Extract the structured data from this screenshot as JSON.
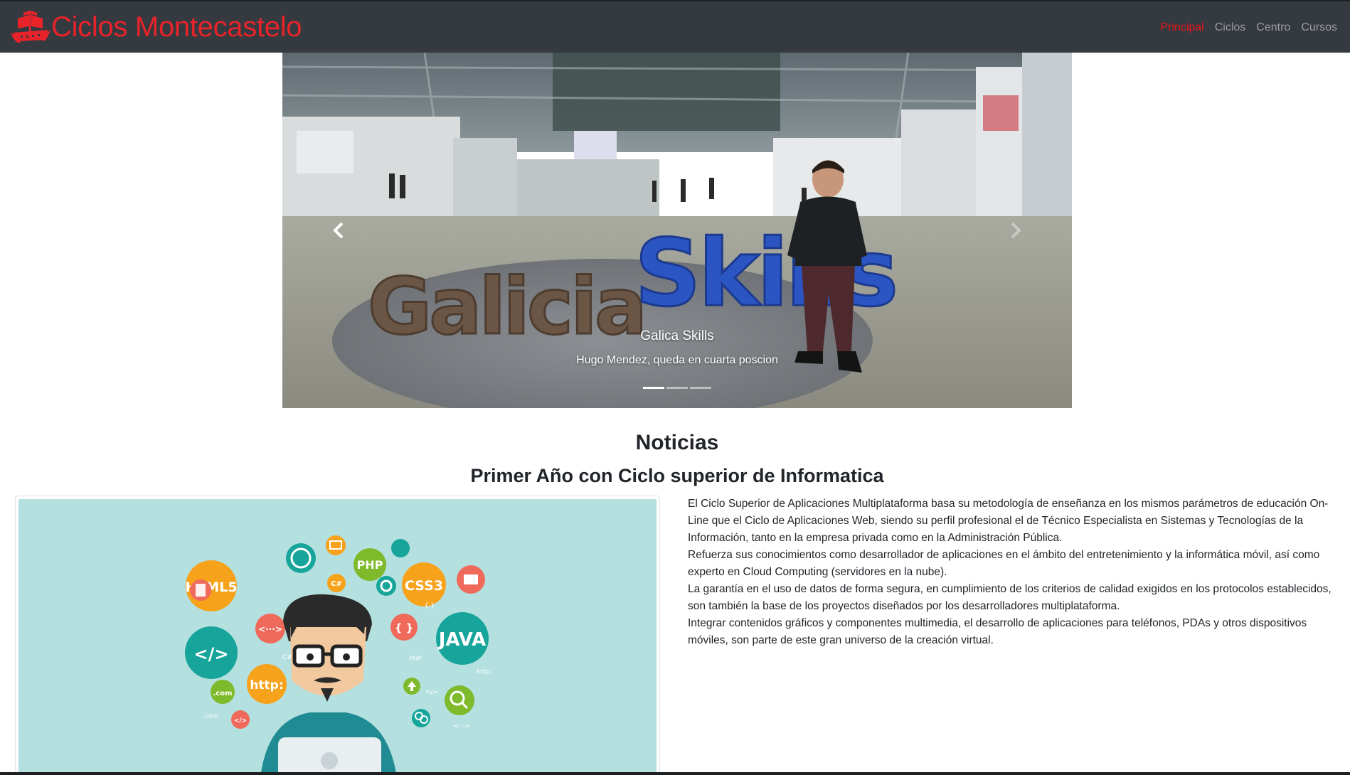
{
  "brand": {
    "name": "Ciclos Montecastelo",
    "color": "#e8232a"
  },
  "nav": {
    "items": [
      {
        "label": "Principal",
        "active": true
      },
      {
        "label": "Ciclos",
        "active": false
      },
      {
        "label": "Centro",
        "active": false
      },
      {
        "label": "Cursos",
        "active": false
      }
    ],
    "background": "#343a40",
    "active_color": "#e8141c",
    "link_color": "#9a9da1"
  },
  "carousel": {
    "slide_text": "Galicia Skills",
    "caption_title": "Galica Skills",
    "caption_text": "Hugo Mendez, queda en cuarta poscion",
    "indicator_count": 3,
    "active_index": 0,
    "prev_icon": "chevron-left-icon",
    "next_icon": "chevron-right-icon"
  },
  "news": {
    "section_title": "Noticias",
    "article_title": "Primer Año con Ciclo superior de Informatica",
    "illustration_badges": [
      "HTML5",
      "PHP",
      "CSS3",
      "</>",
      "JAVA",
      "http:",
      ".com",
      "<···>",
      "{ }",
      "C#",
      "</>"
    ],
    "illustration_small_text": [
      "PHP",
      "http:",
      ".com",
      "</>",
      "<···>",
      "C#",
      "{ }"
    ],
    "paragraphs": [
      "El Ciclo Superior de Aplicaciones Multiplataforma basa su metodología de enseñanza en los mismos parámetros de educación On-Line que el Ciclo de Aplicaciones Web, siendo su perfil profesional el de Técnico Especialista en Sistemas y Tecnologías de la Información, tanto en la empresa privada como en la Administración Pública.",
      "Refuerza sus conocimientos como desarrollador de aplicaciones en el ámbito del entretenimiento y la informática móvil, así como experto en Cloud Computing (servidores en la nube).",
      "La garantía en el uso de datos de forma segura, en cumplimiento de los criterios de calidad exigidos en los protocolos establecidos, son también la base de los proyectos diseñados por los desarrolladores multiplataforma.",
      "Integrar contenidos gráficos y componentes multimedia, el desarrollo de aplicaciones para teléfonos, PDAs y otros dispositivos móviles, son parte de este gran universo de la creación virtual."
    ]
  }
}
